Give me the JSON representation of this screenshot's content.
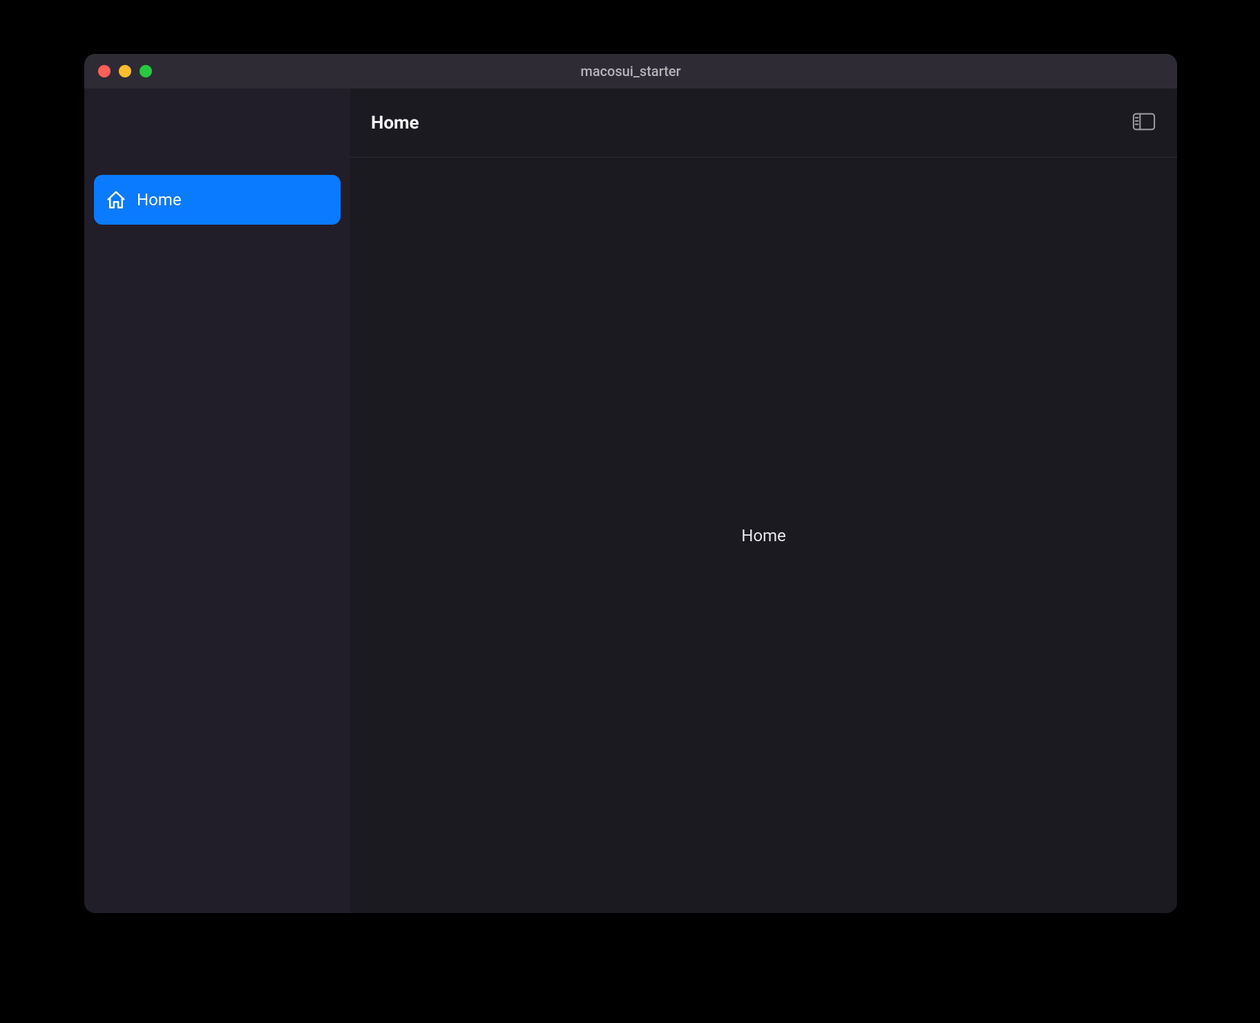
{
  "window": {
    "title": "macosui_starter"
  },
  "sidebar": {
    "items": [
      {
        "icon": "home-icon",
        "label": "Home",
        "selected": true
      }
    ]
  },
  "toolbar": {
    "title": "Home"
  },
  "content": {
    "body_text": "Home"
  },
  "colors": {
    "accent": "#0a7aff",
    "sidebar_bg": "#211d29",
    "content_bg": "#1a1a20",
    "titlebar_bg": "#2f2b34"
  }
}
